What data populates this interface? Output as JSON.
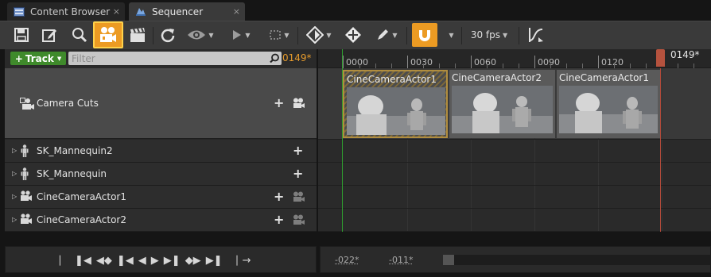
{
  "tabs": [
    {
      "label": "Content Browser",
      "active": false
    },
    {
      "label": "Sequencer",
      "active": true
    }
  ],
  "tab_close_glyph": "×",
  "toolbar": {
    "fps_label": "30 fps",
    "accent_color": "#ec9b23",
    "icons": [
      "save-icon",
      "save-as-icon",
      "find-asset-icon",
      "camera-lock-icon",
      "render-movie-icon",
      "refresh-icon",
      "view-options-icon",
      "playback-options-icon",
      "selection-icon",
      "key-icon",
      "transform-icon",
      "edit-icon",
      "snap-magnet-icon",
      "curve-editor-icon"
    ]
  },
  "outliner": {
    "add_track_label": "Track",
    "filter_placeholder": "Filter",
    "frame_readout": "0149*",
    "camera_cuts_label": "Camera Cuts",
    "tracks": [
      {
        "label": "SK_Mannequin2",
        "type": "mannequin"
      },
      {
        "label": "SK_Mannequin",
        "type": "mannequin"
      },
      {
        "label": "CineCameraActor1",
        "type": "camera"
      },
      {
        "label": "CineCameraActor2",
        "type": "camera"
      }
    ]
  },
  "timeline": {
    "ruler_labels": [
      "0000",
      "0030",
      "0060",
      "0090",
      "0120"
    ],
    "playhead_label": "0149*",
    "shots": [
      {
        "name": "CineCameraActor1",
        "selected": true
      },
      {
        "name": "CineCameraActor2",
        "selected": false
      },
      {
        "name": "CineCameraActor1",
        "selected": false
      }
    ]
  },
  "bottom": {
    "range_start": "-022*",
    "range_end": "-011*"
  }
}
